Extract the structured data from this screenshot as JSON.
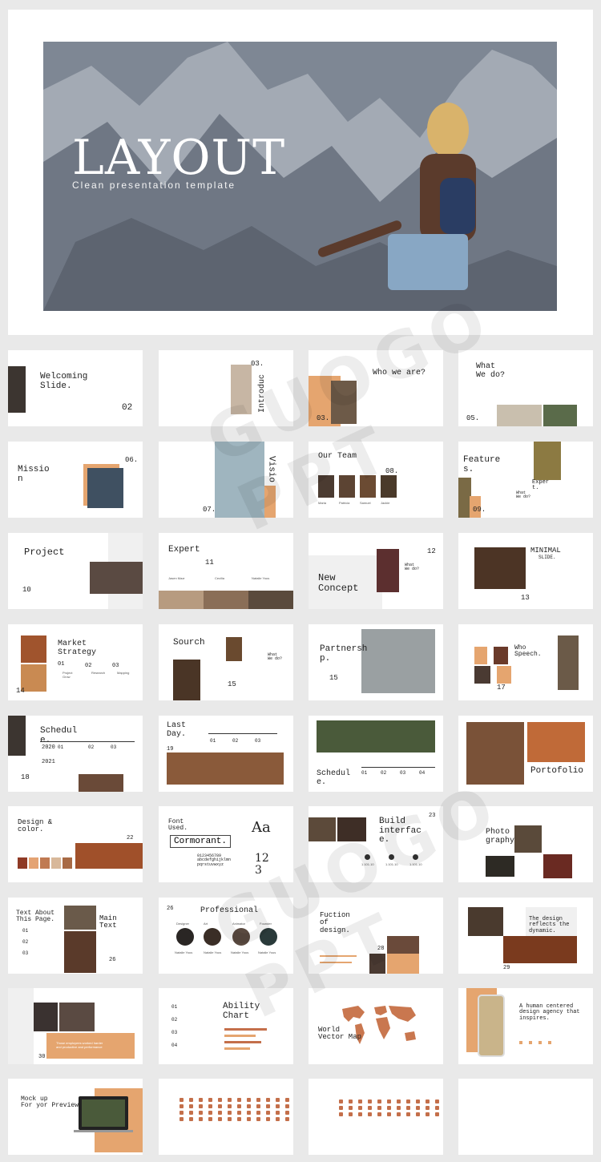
{
  "hero": {
    "title": "LAYOUT",
    "subtitle": "Clean presentation template"
  },
  "slides": {
    "welcoming": {
      "title": "Welcoming\nSlide.",
      "num": "02"
    },
    "introduce": {
      "num": "03.",
      "title": "Introduc"
    },
    "who_we_are": {
      "title": "Who we are?",
      "num": "03."
    },
    "what_we_do": {
      "title": "What\nWe do?",
      "num": "05."
    },
    "mission": {
      "title": "Missio\nn",
      "num": "06.",
      "items": [
        "01",
        "02",
        "03"
      ]
    },
    "vision": {
      "title": "Visio",
      "num": "07."
    },
    "our_team": {
      "title": "Our Team",
      "num": "08.",
      "names": [
        "Maria",
        "Patricia",
        "Samuel",
        "Jackie"
      ]
    },
    "feature": {
      "title": "Feature\ns.",
      "num": "09.",
      "sub": "What\nWe do?",
      "expert": "Exper\nt."
    },
    "project": {
      "title": "Project",
      "num": "10"
    },
    "expert": {
      "title": "Expert",
      "num": "11",
      "names": [
        "Jasen Mazr",
        "Cecilia",
        "Natalie Yous"
      ]
    },
    "new_concept": {
      "title": "New\nConcept",
      "num": "12",
      "sub": "What\nWe do?"
    },
    "minimal": {
      "title": "MINIMAL",
      "sub": "SLIDE.",
      "num": "13"
    },
    "market": {
      "title": "Market\nStrategy",
      "num": "14",
      "steps": [
        "01",
        "02",
        "03"
      ],
      "labels": [
        "Project\nGrow",
        "Research",
        "Mapping"
      ]
    },
    "sourch": {
      "title": "Sourch",
      "num": "15",
      "sub": "What\nWe do?"
    },
    "partnership": {
      "title": "Partnersh\np.",
      "num": "15"
    },
    "who_speech": {
      "title": "Who\nSpeech.",
      "num": "17"
    },
    "schedule": {
      "title": "Schedul\ne.",
      "num": "18",
      "years": [
        "2020",
        "2021"
      ],
      "cols": [
        "01",
        "02",
        "03"
      ]
    },
    "last_day": {
      "title": "Last\nDay.",
      "num": "19",
      "cols": [
        "01",
        "02",
        "03"
      ]
    },
    "schedule2": {
      "title": "Schedul\ne.",
      "cols": [
        "01",
        "02",
        "03",
        "04"
      ]
    },
    "portofolio": {
      "title": "Portofolio"
    },
    "design_color": {
      "title": "Design &\ncolor.",
      "num": "22",
      "swatches": [
        "#8f3a25",
        "#e4a373",
        "#c07a52",
        "#d8b89a",
        "#a86a45"
      ]
    },
    "font_used": {
      "title": "Font\nUsed.",
      "font": "Cormorant.",
      "aa": "Aa",
      "digits": "12\n3",
      "chars": "0123456789\nabcdefghijklmn\npqrstuvwxyz"
    },
    "build_interface": {
      "title": "Build\ninterfac\ne.",
      "num": "23",
      "values": [
        "1.101.10",
        "1.101.10",
        "1.101.10"
      ]
    },
    "photography": {
      "title": "Photo\ngraphy"
    },
    "text_about": {
      "title": "Text About\nThis Page.",
      "main": "Main\nText",
      "num": "26",
      "items": [
        "01",
        "02",
        "03"
      ]
    },
    "professional": {
      "title": "Professional",
      "num": "26",
      "labels": [
        "Designer",
        "Art",
        "Animator",
        "Founder"
      ],
      "names": [
        "Natalie Yous",
        "Natalie Yous",
        "Natalie Yous",
        "Natalie Yous"
      ]
    },
    "fuction": {
      "title": "Fuction\nof\ndesign.",
      "num": "28"
    },
    "design_reflects": {
      "title": "The design\nreflects the\ndynamic.",
      "num": "29"
    },
    "quote": {
      "num": "30",
      "text": "Those employees worked harder\nand productive and performance"
    },
    "ability": {
      "title": "Ability\nChart",
      "items": [
        "01",
        "02",
        "03",
        "04"
      ],
      "bars": [
        0.75,
        0.55,
        0.65,
        0.45
      ]
    },
    "world_map": {
      "title": "World\nVector Map"
    },
    "human_centered": {
      "title": "A human centered\ndesign agency that\ninspires."
    },
    "mockup": {
      "title": "Mock up\nFor yor Preview"
    }
  },
  "watermark": "GUOGO PPT",
  "colors": {
    "accent": "#e5a56f",
    "map": "#c9774f",
    "icon": "#c46f4a"
  }
}
